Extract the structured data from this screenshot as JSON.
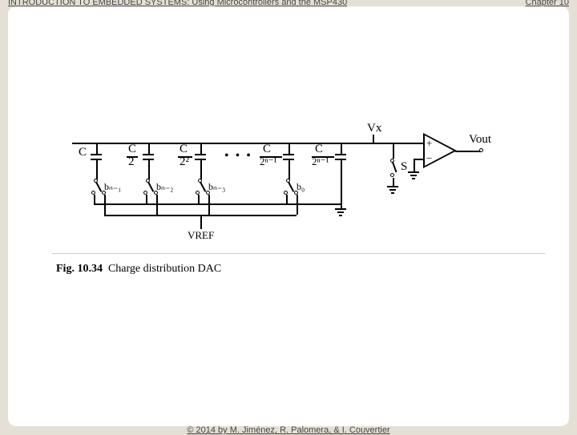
{
  "header": {
    "title": "INTRODUCTION TO EMBEDDED SYSTEMS: Using Microcontrollers and the MSP430",
    "chapter": "Chapter 10"
  },
  "footer": {
    "copyright": "© 2014 by M. Jiménez, R. Palomera, & I. Couvertier"
  },
  "figure": {
    "label": "Fig. 10.34",
    "title": "Charge distribution DAC"
  },
  "diagram": {
    "caps": [
      "C",
      "C",
      "C",
      "C",
      "C"
    ],
    "dens": [
      "",
      "2",
      "2²",
      "2ⁿ⁻¹",
      "2ⁿ⁻¹"
    ],
    "bits": [
      "bₙ₋₁",
      "bₙ₋₂",
      "bₙ₋₃",
      "b₀"
    ],
    "vref": "VREF",
    "vx": "Vx",
    "vout": "Vout",
    "s": "S",
    "plus": "+",
    "minus": "−",
    "dots": "• • •"
  }
}
